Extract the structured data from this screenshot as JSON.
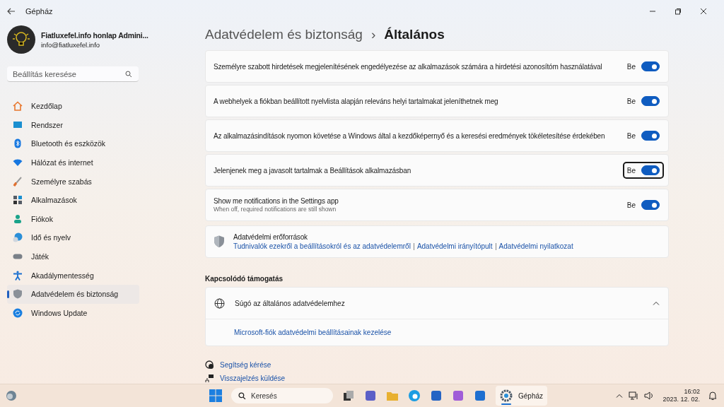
{
  "window": {
    "title": "Gépház"
  },
  "account": {
    "name": "Fiatluxefel.info honlap Admini...",
    "email": "info@fiatluxefel.info"
  },
  "search": {
    "placeholder": "Beállítás keresése"
  },
  "sidebar": {
    "items": [
      {
        "label": "Kezdőlap",
        "selected": false
      },
      {
        "label": "Rendszer",
        "selected": false
      },
      {
        "label": "Bluetooth és eszközök",
        "selected": false
      },
      {
        "label": "Hálózat és internet",
        "selected": false
      },
      {
        "label": "Személyre szabás",
        "selected": false
      },
      {
        "label": "Alkalmazások",
        "selected": false
      },
      {
        "label": "Fiókok",
        "selected": false
      },
      {
        "label": "Idő és nyelv",
        "selected": false
      },
      {
        "label": "Játék",
        "selected": false
      },
      {
        "label": "Akadálymentesség",
        "selected": false
      },
      {
        "label": "Adatvédelem és biztonság",
        "selected": true
      },
      {
        "label": "Windows Update",
        "selected": false
      }
    ]
  },
  "breadcrumb": {
    "parent": "Adatvédelem és biztonság",
    "separator": "›",
    "current": "Általános"
  },
  "settings": [
    {
      "label": "Személyre szabott hirdetések megjelenítésének engedélyezése az alkalmazások számára a hirdetési azonosítóm használatával",
      "state_label": "Be",
      "on": true,
      "focused": false
    },
    {
      "label": "A webhelyek a fiókban beállított nyelvlista alapján releváns helyi tartalmakat jeleníthetnek meg",
      "state_label": "Be",
      "on": true,
      "focused": false
    },
    {
      "label": "Az alkalmazásindítások nyomon követése a Windows által a kezdőképernyő és a keresési eredmények tökéletesítése érdekében",
      "state_label": "Be",
      "on": true,
      "focused": false
    },
    {
      "label": "Jelenjenek meg a javasolt tartalmak a Beállítások alkalmazásban",
      "state_label": "Be",
      "on": true,
      "focused": true
    },
    {
      "label": "Show me notifications in the Settings app",
      "description": "When off, required notifications are still shown",
      "state_label": "Be",
      "on": true,
      "focused": false
    }
  ],
  "resources": {
    "title": "Adatvédelmi erőforrások",
    "links": [
      "Tudnivalók ezekről a beállításokról és az adatvédelemről",
      "Adatvédelmi irányítópult",
      "Adatvédelmi nyilatkozat"
    ]
  },
  "related_support": {
    "heading": "Kapcsolódó támogatás",
    "title": "Súgó az általános adatvédelemhez",
    "expanded": true,
    "links": [
      "Microsoft-fiók adatvédelmi beállításainak kezelése"
    ]
  },
  "footer_links": [
    "Segítség kérése",
    "Visszajelzés küldése"
  ],
  "taskbar": {
    "search_placeholder": "Keresés",
    "app_label": "Gépház",
    "time": "16:02",
    "date": "2023. 12. 02."
  }
}
